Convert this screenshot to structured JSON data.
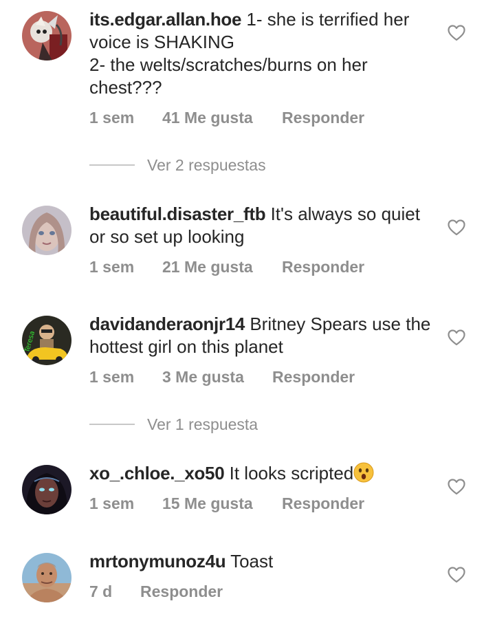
{
  "comments": [
    {
      "username": "its.edgar.allan.hoe",
      "text": "1- she is terrified her voice is SHAKING",
      "text2": "2- the welts/scratches/burns on her chest???",
      "time": "1 sem",
      "likes": "41 Me gusta",
      "reply": "Responder",
      "replies_label": "Ver 2 respuestas"
    },
    {
      "username": "beautiful.disaster_ftb",
      "text": "It's always so quiet or so set up looking",
      "time": "1 sem",
      "likes": "21 Me gusta",
      "reply": "Responder"
    },
    {
      "username": "davidanderaonjr14",
      "text": "Britney Spears use the hottest girl on this planet",
      "time": "1 sem",
      "likes": "3 Me gusta",
      "reply": "Responder",
      "replies_label": "Ver 1 respuesta",
      "avatar_text": "Teresa"
    },
    {
      "username": "xo_.chloe._xo50",
      "text": "It looks scripted",
      "time": "1 sem",
      "likes": "15 Me gusta",
      "reply": "Responder",
      "emoji": "astonished-face-emoji"
    },
    {
      "username": "mrtonymunoz4u",
      "text": "Toast",
      "time": "7 d",
      "reply": "Responder"
    }
  ],
  "colors": {
    "text": "#262626",
    "secondary": "#8e8e8e",
    "divider": "#c7c7c7"
  }
}
